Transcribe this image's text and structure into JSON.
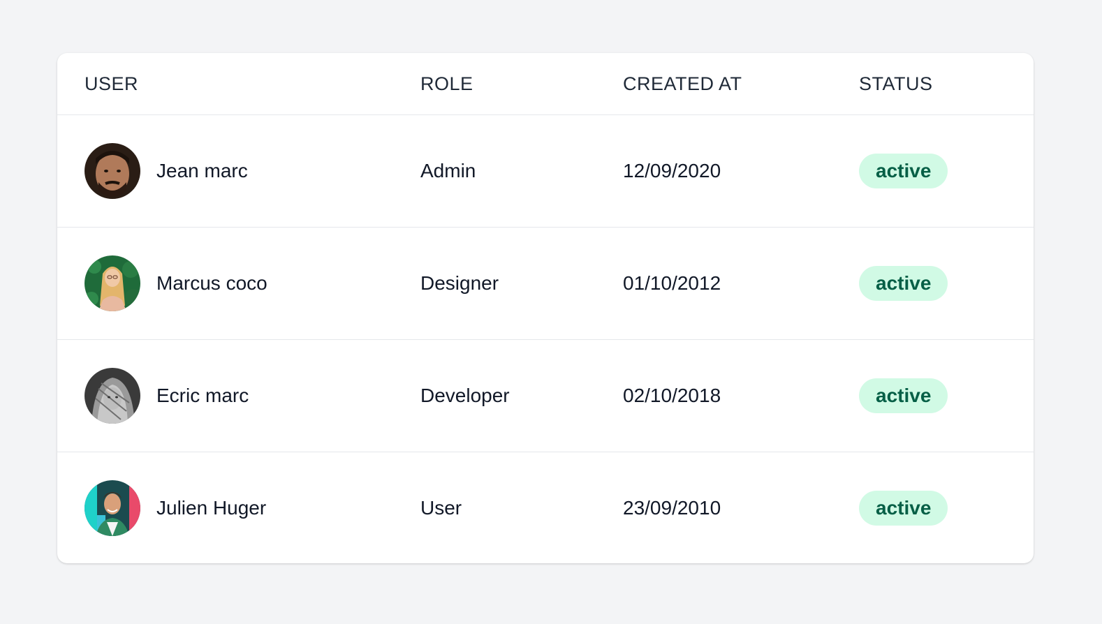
{
  "table": {
    "headers": {
      "user": "USER",
      "role": "ROLE",
      "created_at": "CREATED AT",
      "status": "STATUS"
    },
    "rows": [
      {
        "name": "Jean marc",
        "role": "Admin",
        "created_at": "12/09/2020",
        "status": "active"
      },
      {
        "name": "Marcus coco",
        "role": "Designer",
        "created_at": "01/10/2012",
        "status": "active"
      },
      {
        "name": "Ecric marc",
        "role": "Developer",
        "created_at": "02/10/2018",
        "status": "active"
      },
      {
        "name": "Julien Huger",
        "role": "User",
        "created_at": "23/09/2010",
        "status": "active"
      }
    ]
  },
  "colors": {
    "page_background": "#f3f4f6",
    "card_background": "#ffffff",
    "status_badge_background": "#d1fae5",
    "status_badge_text": "#065f46"
  }
}
